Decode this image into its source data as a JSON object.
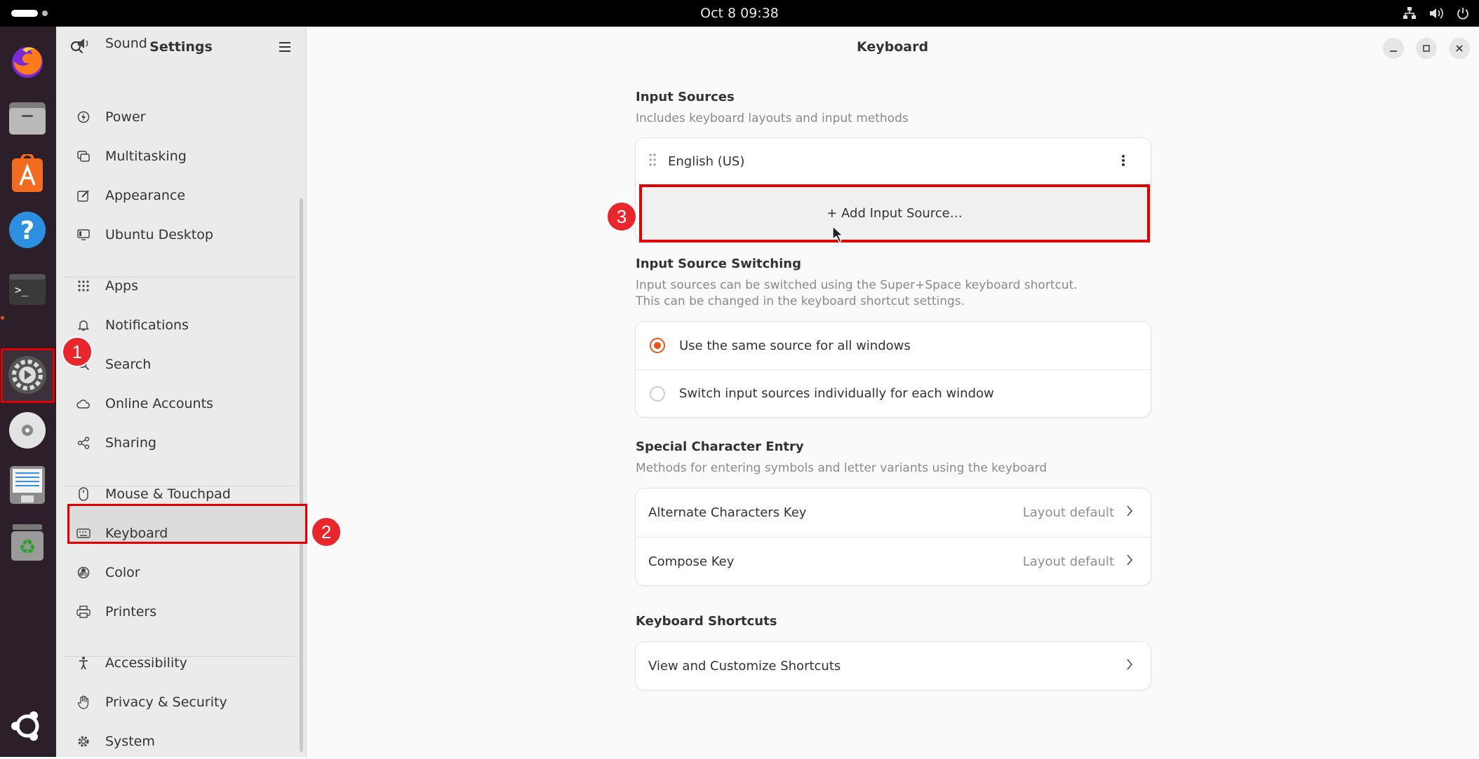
{
  "topbar": {
    "clock": "Oct 8  09:38",
    "tray_icons": [
      "network-icon",
      "volume-icon",
      "power-icon"
    ]
  },
  "dock": {
    "apps": [
      {
        "name": "firefox-icon"
      },
      {
        "name": "files-icon"
      },
      {
        "name": "app-center-icon"
      },
      {
        "name": "help-icon"
      },
      {
        "name": "terminal-icon"
      },
      {
        "name": "settings-icon"
      },
      {
        "name": "disc-icon"
      },
      {
        "name": "text-editor-icon"
      },
      {
        "name": "trash-icon"
      },
      {
        "name": "ubuntu-logo-icon"
      }
    ]
  },
  "sidebar": {
    "title": "Settings",
    "items": [
      {
        "label": "Sound",
        "icon": "sound-icon"
      },
      {
        "label": "Power",
        "icon": "power-icon"
      },
      {
        "label": "Multitasking",
        "icon": "multitasking-icon"
      },
      {
        "label": "Appearance",
        "icon": "appearance-icon"
      },
      {
        "label": "Ubuntu Desktop",
        "icon": "ubuntu-desktop-icon"
      },
      {
        "label": "Apps",
        "icon": "apps-icon"
      },
      {
        "label": "Notifications",
        "icon": "bell-icon"
      },
      {
        "label": "Search",
        "icon": "search-icon"
      },
      {
        "label": "Online Accounts",
        "icon": "cloud-icon"
      },
      {
        "label": "Sharing",
        "icon": "share-icon"
      },
      {
        "label": "Mouse & Touchpad",
        "icon": "mouse-icon"
      },
      {
        "label": "Keyboard",
        "icon": "keyboard-icon"
      },
      {
        "label": "Color",
        "icon": "color-icon"
      },
      {
        "label": "Printers",
        "icon": "printer-icon"
      },
      {
        "label": "Accessibility",
        "icon": "accessibility-icon"
      },
      {
        "label": "Privacy & Security",
        "icon": "hand-icon"
      },
      {
        "label": "System",
        "icon": "gear-icon"
      }
    ]
  },
  "main": {
    "title": "Keyboard",
    "input_sources": {
      "title": "Input Sources",
      "subtitle": "Includes keyboard layouts and input methods",
      "source": "English (US)",
      "add_label": "+  Add Input Source…"
    },
    "switching": {
      "title": "Input Source Switching",
      "subtitle_1": "Input sources can be switched using the Super+Space keyboard shortcut.",
      "subtitle_2": "This can be changed in the keyboard shortcut settings.",
      "option_1": "Use the same source for all windows",
      "option_2": "Switch input sources individually for each window",
      "selected": 1
    },
    "special": {
      "title": "Special Character Entry",
      "subtitle": "Methods for entering symbols and letter variants using the keyboard",
      "alt_key_label": "Alternate Characters Key",
      "alt_key_value": "Layout default",
      "compose_label": "Compose Key",
      "compose_value": "Layout default"
    },
    "shortcuts": {
      "title": "Keyboard Shortcuts",
      "view_label": "View and Customize Shortcuts"
    }
  },
  "annotations": {
    "badge_1": "1",
    "badge_2": "2",
    "badge_3": "3",
    "highlight_color": "#e00000",
    "accent_color": "#e95420"
  }
}
